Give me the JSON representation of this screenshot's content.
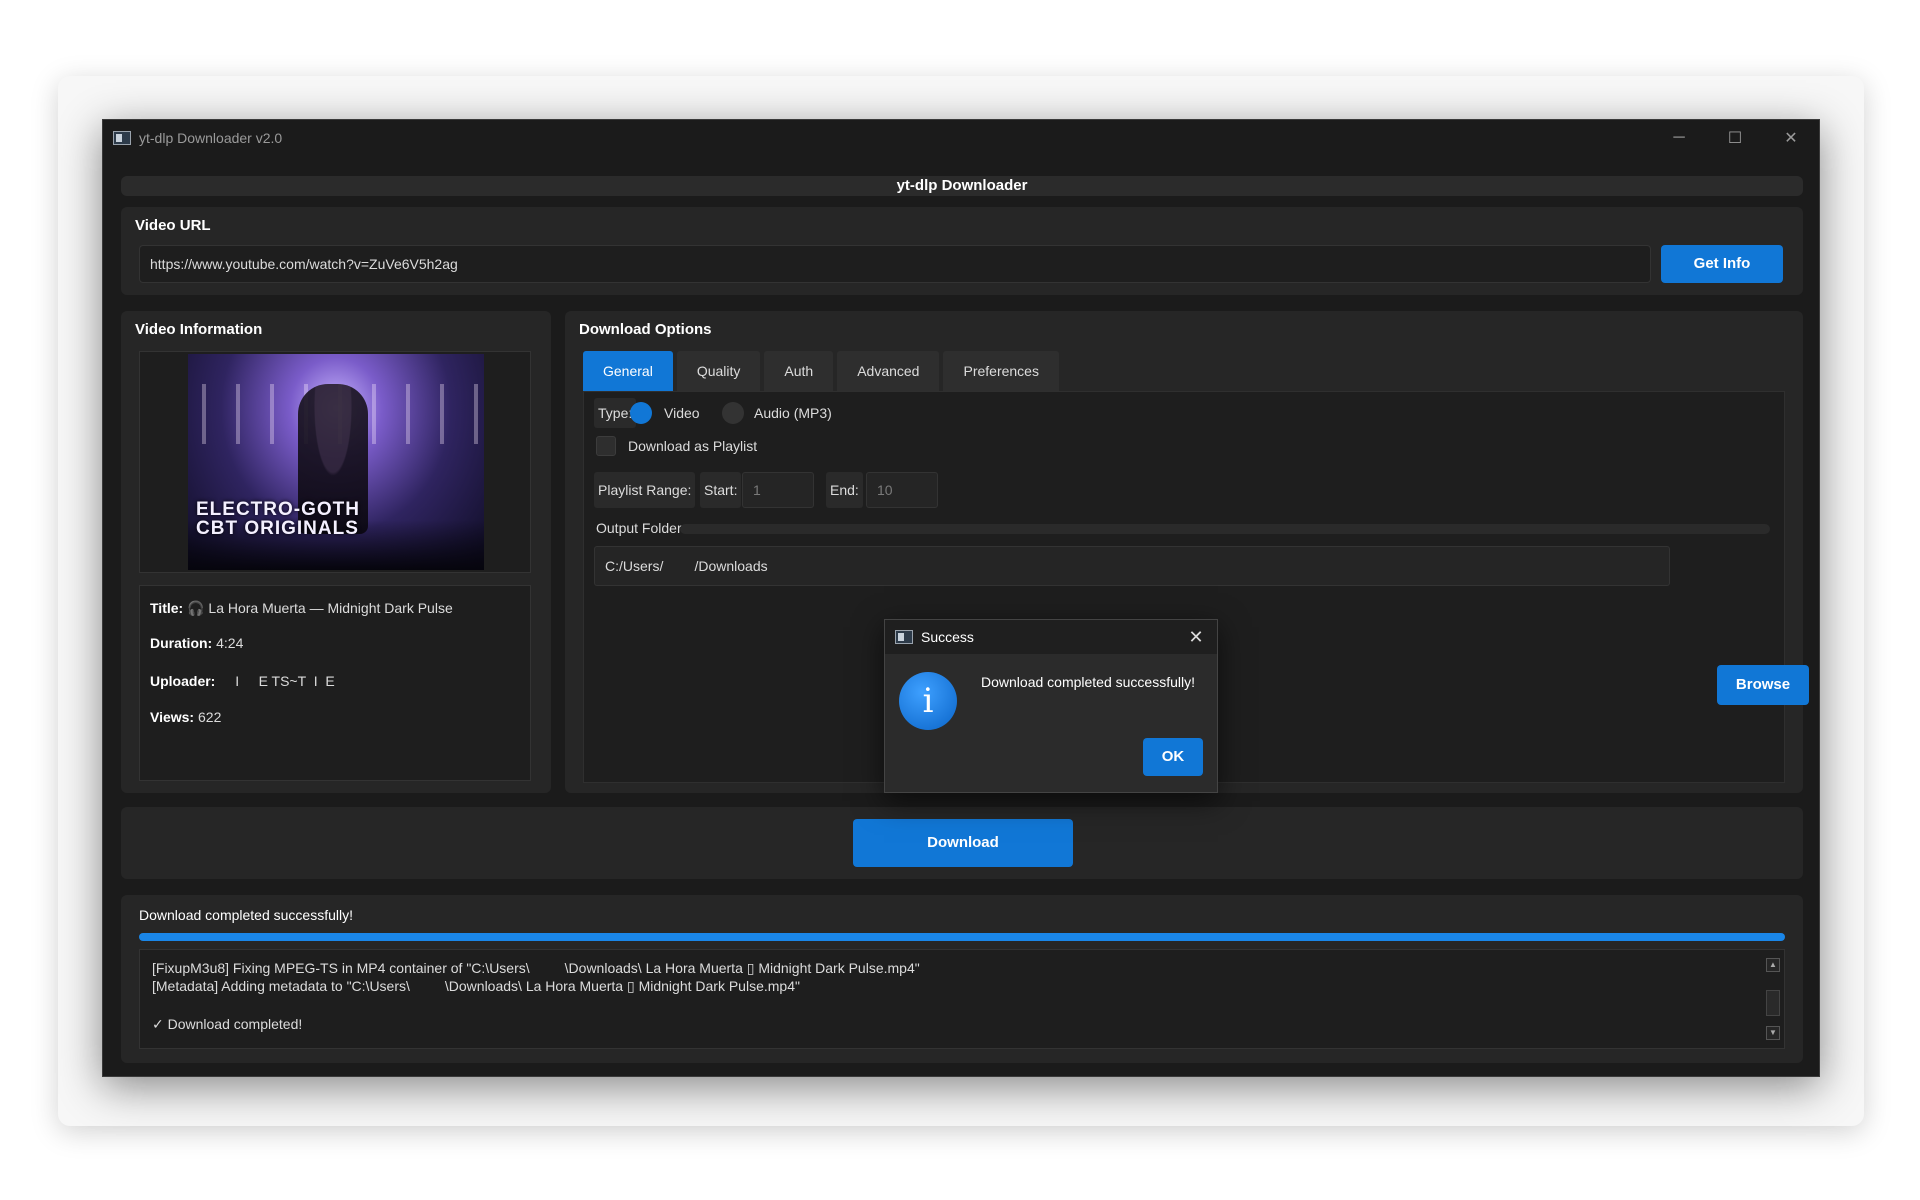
{
  "window": {
    "title": "yt-dlp Downloader v2.0",
    "header": "yt-dlp Downloader",
    "controls": {
      "minimize": "─",
      "maximize": "☐",
      "close": "✕"
    }
  },
  "url_section": {
    "label": "Video URL",
    "value": "https://www.youtube.com/watch?v=ZuVe6V5h2ag",
    "button": "Get Info"
  },
  "video_info": {
    "label": "Video Information",
    "thumbnail_text_line1": "ELECTRO-GOTH",
    "thumbnail_text_line2": "CBT ORIGINALS",
    "title_label": "Title:",
    "title_value": "🎧 La Hora Muerta — Midnight Dark Pulse",
    "duration_label": "Duration:",
    "duration_value": "4:24",
    "uploader_label": "Uploader:",
    "uploader_value": "I     E TS~T  I  E",
    "views_label": "Views:",
    "views_value": "622"
  },
  "options": {
    "label": "Download Options",
    "tabs": [
      "General",
      "Quality",
      "Auth",
      "Advanced",
      "Preferences"
    ],
    "active_tab": "General",
    "type_label": "Type:",
    "type_video": "Video",
    "type_audio": "Audio (MP3)",
    "playlist_checkbox": "Download as Playlist",
    "playlist_range_label": "Playlist Range:",
    "start_label": "Start:",
    "start_value": "1",
    "end_label": "End:",
    "end_value": "10",
    "output_label": "Output Folder:",
    "output_value": "C:/Users/        /Downloads",
    "browse_button": "Browse"
  },
  "download_button": "Download",
  "status": {
    "text": "Download completed successfully!",
    "progress": 1.0
  },
  "log": {
    "line1": "[FixupM3u8] Fixing MPEG-TS in MP4 container of \"C:\\Users\\         \\Downloads\\ La Hora Muerta ▯ Midnight Dark Pulse.mp4\"",
    "line2": "[Metadata] Adding metadata to \"C:\\Users\\         \\Downloads\\ La Hora Muerta ▯ Midnight Dark Pulse.mp4\"",
    "line3": "✓ Download completed!"
  },
  "dialog": {
    "title": "Success",
    "message": "Download completed successfully!",
    "icon": "i",
    "ok_button": "OK",
    "close": "✕"
  },
  "colors": {
    "accent": "#1177d6",
    "window_bg": "#1b1b1b",
    "panel_bg": "#262626"
  }
}
